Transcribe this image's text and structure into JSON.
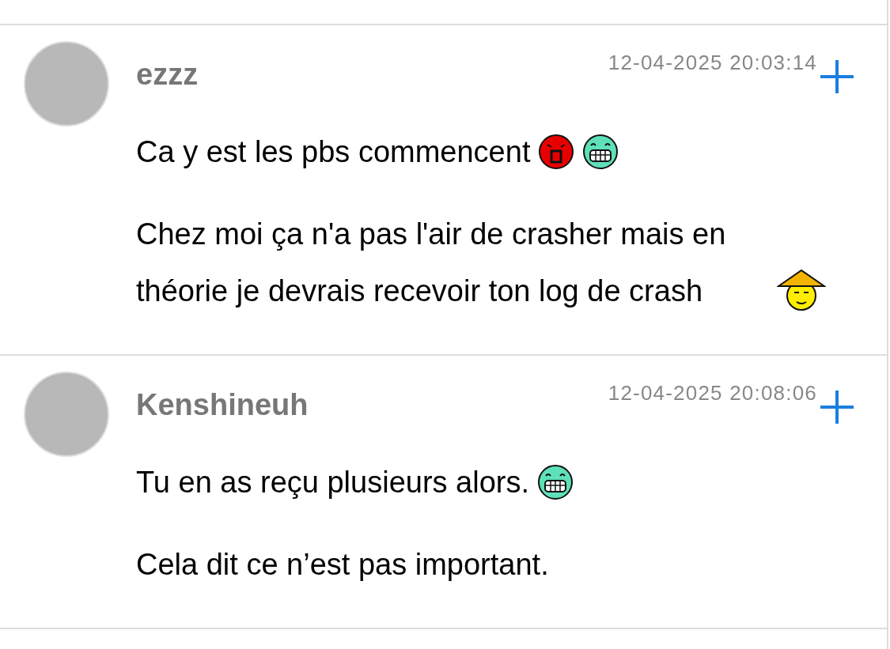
{
  "posts": [
    {
      "author": "ezzz",
      "date": "12-04-2025 20:03:14",
      "paragraphs": [
        {
          "text": "Ca y est les pbs commencent",
          "smileys": [
            {
              "kind": "angry"
            },
            {
              "kind": "grin"
            }
          ]
        },
        {
          "text": "Chez moi ça n'a pas l'air de crasher mais en théorie je devrais recevoir ton log de crash",
          "smileys": [
            {
              "kind": "hat"
            }
          ]
        }
      ]
    },
    {
      "author": "Kenshineuh",
      "date": "12-04-2025 20:08:06",
      "paragraphs": [
        {
          "text": "Tu en as reçu plusieurs alors.",
          "smileys": [
            {
              "kind": "grin"
            }
          ]
        },
        {
          "text": "Cela dit ce n’est pas important."
        }
      ]
    }
  ]
}
